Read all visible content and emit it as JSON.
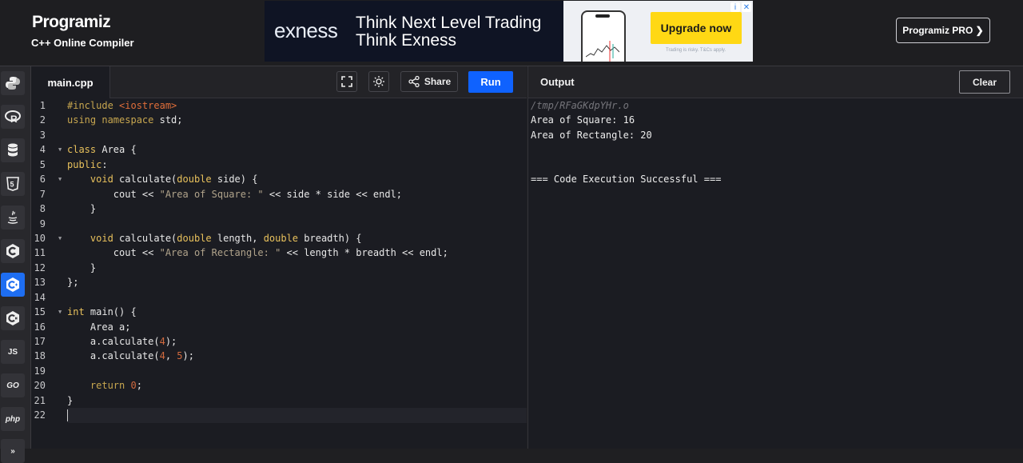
{
  "header": {
    "brand": "Programiz",
    "subtitle": "C++ Online Compiler",
    "pro_button": "Programiz PRO ❯"
  },
  "ad": {
    "brand": "exness",
    "line1": "Think Next Level Trading",
    "line2": "Think Exness",
    "cta": "Upgrade now",
    "disclaimer": "Trading is risky. T&Cs apply.",
    "info_icon": "i",
    "close_icon": "✕"
  },
  "sidebar": {
    "items": [
      {
        "name": "python",
        "icon": "python-icon"
      },
      {
        "name": "r",
        "icon": "r-icon"
      },
      {
        "name": "sql",
        "icon": "database-icon"
      },
      {
        "name": "html",
        "icon": "html5-icon"
      },
      {
        "name": "java",
        "icon": "java-icon"
      },
      {
        "name": "c",
        "icon": "c-icon"
      },
      {
        "name": "cpp",
        "icon": "cpp-icon",
        "active": true
      },
      {
        "name": "csharp",
        "icon": "csharp-icon"
      },
      {
        "name": "js",
        "label": "JS"
      },
      {
        "name": "go",
        "label": "GO"
      },
      {
        "name": "php",
        "label": "php"
      },
      {
        "name": "more",
        "label": "»"
      }
    ]
  },
  "editor": {
    "filename": "main.cpp",
    "share_label": "Share",
    "run_label": "Run",
    "line_numbers": [
      "1",
      "2",
      "3",
      "4",
      "5",
      "6",
      "7",
      "8",
      "9",
      "10",
      "11",
      "12",
      "13",
      "14",
      "15",
      "16",
      "17",
      "18",
      "19",
      "20",
      "21",
      "22"
    ],
    "code": {
      "l1a": "#include ",
      "l1b": "<iostream>",
      "l2a": "using namespace",
      "l2b": " std;",
      "l4a": "class",
      "l4b": " Area {",
      "l5a": "public",
      "l5b": ":",
      "l6a": "    ",
      "l6b": "void",
      "l6c": " calculate(",
      "l6d": "double",
      "l6e": " side) {",
      "l7a": "        cout << ",
      "l7b": "\"Area of Square: \"",
      "l7c": " << side * side << endl;",
      "l8": "    }",
      "l10a": "    ",
      "l10b": "void",
      "l10c": " calculate(",
      "l10d": "double",
      "l10e": " length, ",
      "l10f": "double",
      "l10g": " breadth) {",
      "l11a": "        cout << ",
      "l11b": "\"Area of Rectangle: \"",
      "l11c": " << length * breadth << endl;",
      "l12": "    }",
      "l13": "};",
      "l15a": "int",
      "l15b": " main() {",
      "l16": "    Area a;",
      "l17a": "    a.calculate(",
      "l17b": "4",
      "l17c": ");",
      "l18a": "    a.calculate(",
      "l18b": "4",
      "l18c": ", ",
      "l18d": "5",
      "l18e": ");",
      "l20a": "    ",
      "l20b": "return",
      "l20c": " ",
      "l20d": "0",
      "l20e": ";",
      "l21": "}"
    }
  },
  "output": {
    "title": "Output",
    "clear_label": "Clear",
    "lines": [
      "/tmp/RFaGKdpYHr.o",
      "Area of Square: 16",
      "Area of Rectangle: 20",
      "",
      "",
      "=== Code Execution Successful ==="
    ]
  },
  "colors": {
    "run_button": "#0f62fe",
    "active_language": "#1e6ef2",
    "ad_cta": "#ffd814"
  }
}
